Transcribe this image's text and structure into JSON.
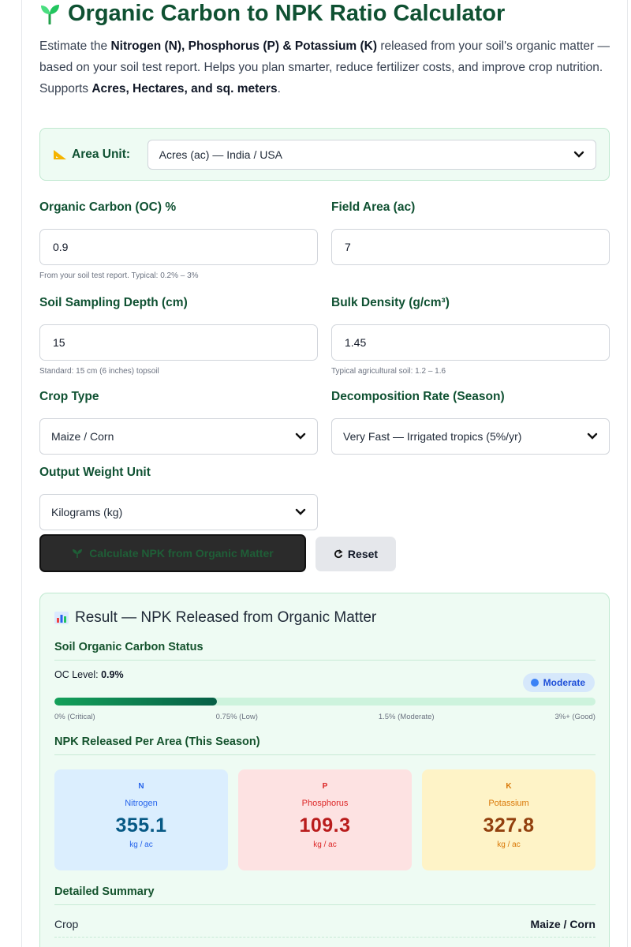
{
  "header": {
    "title": "Organic Carbon to NPK Ratio Calculator",
    "intro_1": "Estimate the ",
    "intro_b1": "Nitrogen (N), Phosphorus (P) & Potassium (K)",
    "intro_2": " released from your soil's organic matter — based on your soil test report. Helps you plan smarter, reduce fertilizer costs, and improve crop nutrition. Supports ",
    "intro_b2": "Acres, Hectares, and sq. meters",
    "intro_3": "."
  },
  "area_unit": {
    "label": "Area Unit:",
    "value": "Acres (ac) — India / USA"
  },
  "fields": {
    "oc": {
      "label": "Organic Carbon (OC) %",
      "value": "0.9",
      "hint": "From your soil test report. Typical: 0.2% – 3%"
    },
    "area": {
      "label": "Field Area (ac)",
      "value": "7"
    },
    "depth": {
      "label": "Soil Sampling Depth (cm)",
      "value": "15",
      "hint": "Standard: 15 cm (6 inches) topsoil"
    },
    "density": {
      "label": "Bulk Density (g/cm³)",
      "value": "1.45",
      "hint": "Typical agricultural soil: 1.2 – 1.6"
    },
    "crop": {
      "label": "Crop Type",
      "value": "Maize / Corn"
    },
    "decomp": {
      "label": "Decomposition Rate (Season)",
      "value": "Very Fast — Irrigated tropics (5%/yr)"
    },
    "weight": {
      "label": "Output Weight Unit",
      "value": "Kilograms (kg)"
    }
  },
  "buttons": {
    "calculate": "Calculate NPK from Organic Matter",
    "reset": "Reset"
  },
  "result": {
    "title": "Result — NPK Released from Organic Matter",
    "status_heading": "Soil Organic Carbon Status",
    "oc_level_label": "OC Level: ",
    "oc_level_value": "0.9%",
    "status_badge": "Moderate",
    "oc_bar_fraction": 0.3,
    "ticks": [
      "0% (Critical)",
      "0.75% (Low)",
      "1.5% (Moderate)",
      "3%+ (Good)"
    ],
    "npk_heading": "NPK Released Per Area (This Season)",
    "cards": {
      "n": {
        "symbol": "N",
        "name": "Nitrogen",
        "value": "355.1",
        "unit": "kg / ac"
      },
      "p": {
        "symbol": "P",
        "name": "Phosphorus",
        "value": "109.3",
        "unit": "kg / ac"
      },
      "k": {
        "symbol": "K",
        "name": "Potassium",
        "value": "327.8",
        "unit": "kg / ac"
      }
    },
    "summary_heading": "Detailed Summary",
    "summary": {
      "crop_label": "Crop",
      "crop_value": "Maize / Corn"
    }
  }
}
